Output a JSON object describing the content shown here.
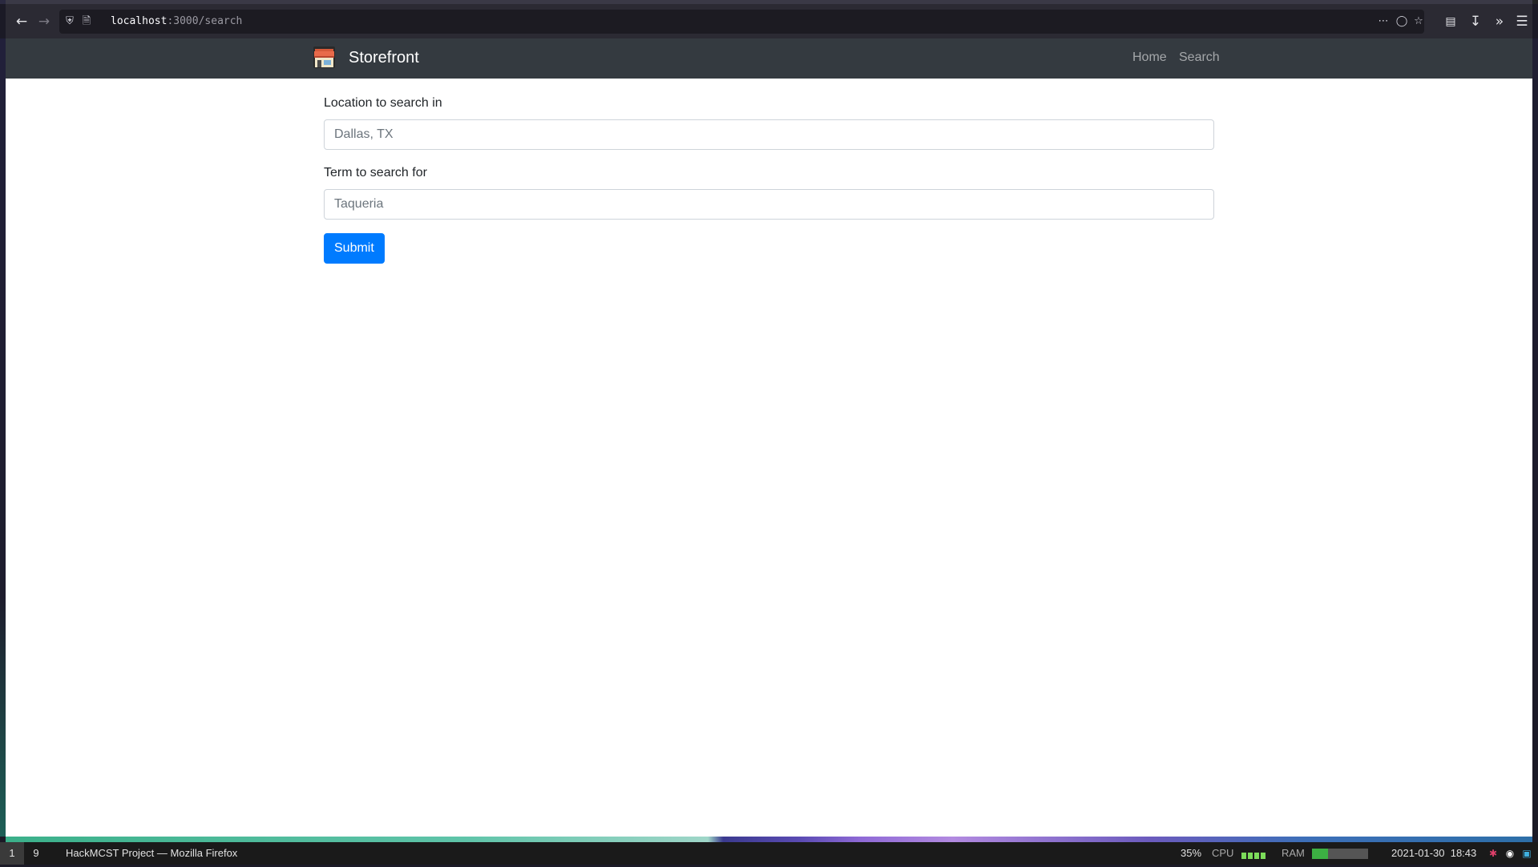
{
  "browser": {
    "url_host": "localhost",
    "url_rest": ":3000/search",
    "icons": {
      "back": "arrow-left-icon",
      "forward": "arrow-right-icon",
      "shield": "shield-icon",
      "page": "page-icon",
      "more": "more-horizontal-icon",
      "pocket": "pocket-icon",
      "bookmark": "star-icon",
      "library": "library-icon",
      "downloads": "download-icon",
      "overflow": "chevron-double-right-icon",
      "menu": "hamburger-menu-icon"
    }
  },
  "navbar": {
    "brand": "Storefront",
    "links": [
      "Home",
      "Search"
    ]
  },
  "form": {
    "location_label": "Location to search in",
    "location_placeholder": "Dallas, TX",
    "location_value": "",
    "term_label": "Term to search for",
    "term_placeholder": "Taqueria",
    "term_value": "",
    "submit_label": "Submit"
  },
  "taskbar": {
    "workspaces": [
      "1",
      "9"
    ],
    "active_workspace": "1",
    "window_title": "HackMCST Project — Mozilla Firefox",
    "cpu_percent": "35%",
    "cpu_label": "CPU",
    "ram_label": "RAM",
    "datetime": "2021-01-30  18:43"
  },
  "colors": {
    "navbar_bg": "#343a40",
    "primary": "#007bff",
    "browser_chrome": "#2b2a33"
  }
}
